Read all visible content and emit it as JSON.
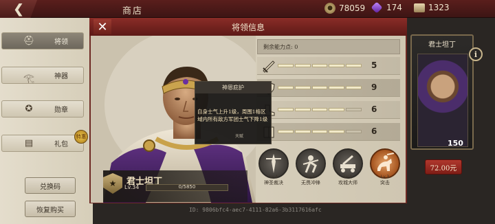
{
  "topbar": {
    "back_icon": "back-arrow-icon",
    "title": "商店",
    "resources": [
      {
        "icon": "coin-icon",
        "value": "78059"
      },
      {
        "icon": "gem-icon",
        "value": "174"
      },
      {
        "icon": "chest-icon",
        "value": "1323"
      }
    ]
  },
  "sidebar": {
    "items": [
      {
        "icon": "helmet-icon",
        "label": "将领",
        "active": true
      },
      {
        "icon": "eye-of-horus-icon",
        "label": "神器",
        "active": false
      },
      {
        "icon": "eagle-icon",
        "label": "勋章",
        "active": false
      },
      {
        "icon": "gift-icon",
        "label": "礼包",
        "active": false
      }
    ],
    "badge": "特惠",
    "redeem": "兑换码",
    "restore": "恢复购买"
  },
  "shop_card": {
    "title": "君士坦丁",
    "count": "150",
    "price": "72.00元"
  },
  "modal": {
    "title": "将领信息",
    "skill_points": "剩余能力点: 0",
    "hero": {
      "name": "君士坦丁",
      "level": "Lv.34",
      "exp": "0/5850",
      "exp_progress": 0
    },
    "attributes": [
      {
        "icon": "sword-icon",
        "filled": 5,
        "total": 5,
        "value": "5"
      },
      {
        "icon": "shield-icon",
        "filled": 5,
        "total": 5,
        "value": "9"
      },
      {
        "icon": "boot-icon",
        "filled": 4,
        "total": 5,
        "value": "6"
      },
      {
        "icon": "book-icon",
        "filled": 4,
        "total": 5,
        "value": "6"
      }
    ],
    "tooltip": {
      "title": "神恩庇护",
      "body": "自身士气上升1级，周围1格区域内所有敌方军团士气下降1级",
      "foot": "天赋"
    },
    "skills": [
      {
        "icon": "holy-spear-icon",
        "level": "Lv.4",
        "name": "神圣裁决",
        "active": false
      },
      {
        "icon": "charging-soldier-icon",
        "level": "Lv.4",
        "name": "无畏冲锋",
        "active": false
      },
      {
        "icon": "siege-engine-icon",
        "level": "Lv.4",
        "name": "攻城大师",
        "active": false
      },
      {
        "icon": "cavalry-icon",
        "level": "Lv.3",
        "name": "突击",
        "active": true
      }
    ]
  },
  "footer": {
    "id": "ID: 9806bfc4-aec7-4111-82a6-3b3117616afc"
  },
  "colors": {
    "header_red": "#8a2c27",
    "panel_parchment": "#d8d0bd",
    "gold": "#cbb27a"
  }
}
